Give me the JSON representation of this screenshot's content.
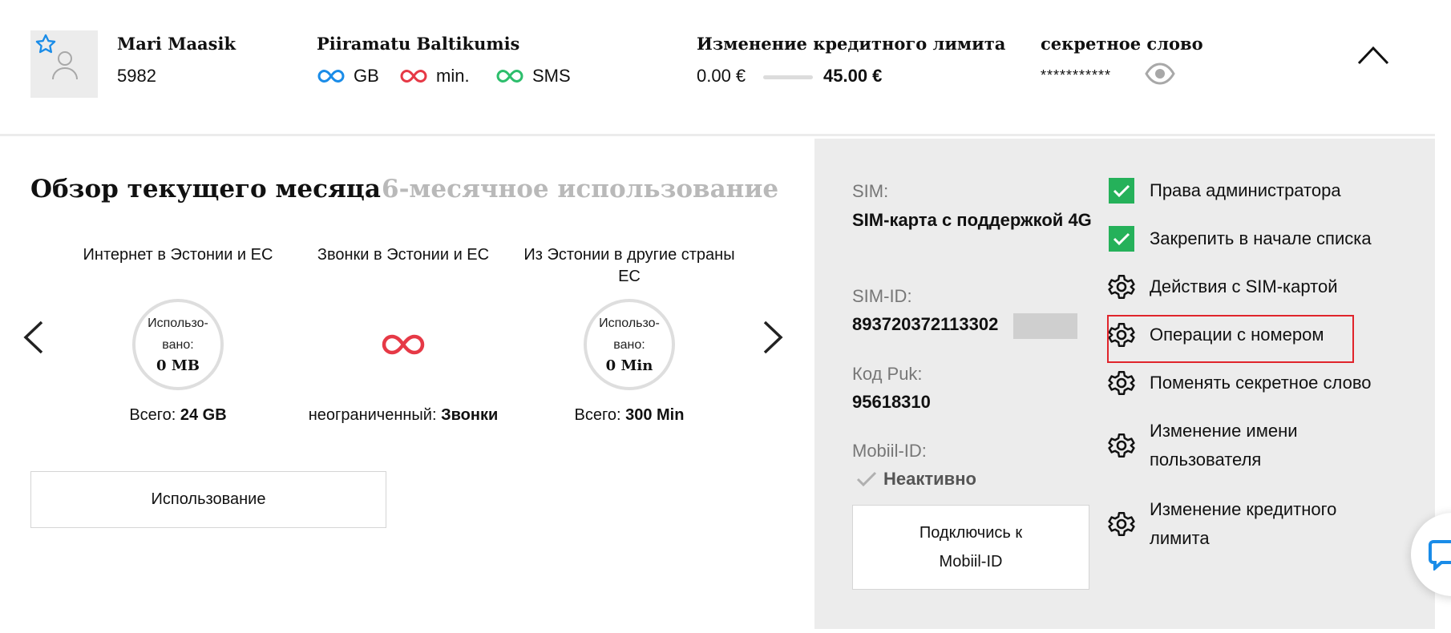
{
  "header": {
    "user_name": "Mari Maasik",
    "user_number": "5982",
    "plan_name": "Piiramatu Baltikumis",
    "allowances": [
      {
        "unit": "GB",
        "color": "#1a8ce8"
      },
      {
        "unit": "min.",
        "color": "#e63946"
      },
      {
        "unit": "SMS",
        "color": "#2dbe6c"
      }
    ],
    "credit_limit": {
      "title": "Изменение кредитного лимита",
      "min": "0.00 €",
      "max": "45.00 €"
    },
    "secret": {
      "title": "секретное слово",
      "value": "***********"
    }
  },
  "tabs": {
    "current": "Обзор текущего месяца",
    "six_month": "6-месячное использование"
  },
  "usage_cards": [
    {
      "title": "Интернет в Эстонии и ЕС",
      "used_label": "Использо-\nвано:",
      "used_value": "0 MB",
      "total_label": "Всего:",
      "total_value": "24 GB"
    },
    {
      "title": "Звонки в Эстонии и ЕС",
      "total_label": "неограниченный:",
      "total_value": "Звонки"
    },
    {
      "title": "Из Эстонии в другие страны ЕС",
      "used_label": "Использо-\nвано:",
      "used_value": "0 Min",
      "total_label": "Всего:",
      "total_value": "300 Min"
    }
  ],
  "usage_button": "Использование",
  "sim": {
    "sim_label": "SIM:",
    "sim_value": "SIM-карта с поддержкой 4G",
    "simid_label": "SIM-ID:",
    "simid_value": "893720372113302",
    "puk_label": "Код Puk:",
    "puk_value": "95618310",
    "mobiil_label": "Mobiil-ID:",
    "mobiil_status": "Неактивно",
    "connect_button": "Подключись к Mobiil-ID"
  },
  "actions": [
    {
      "label": "Права администратора",
      "icon": "checkbox-checked-icon"
    },
    {
      "label": "Закрепить в начале списка",
      "icon": "checkbox-checked-icon"
    },
    {
      "label": "Действия с SIM-картой",
      "icon": "gear-icon"
    },
    {
      "label": "Операции с номером",
      "icon": "gear-icon"
    },
    {
      "label": "Поменять секретное слово",
      "icon": "gear-icon"
    },
    {
      "label": "Изменение имени пользователя",
      "icon": "gear-icon"
    },
    {
      "label": "Изменение кредитного лимита",
      "icon": "gear-icon"
    }
  ],
  "colors": {
    "accent_green": "#25b15a",
    "highlight_red": "#e0242b",
    "infinity_red": "#e63946",
    "chat_blue": "#1a8ce8"
  }
}
